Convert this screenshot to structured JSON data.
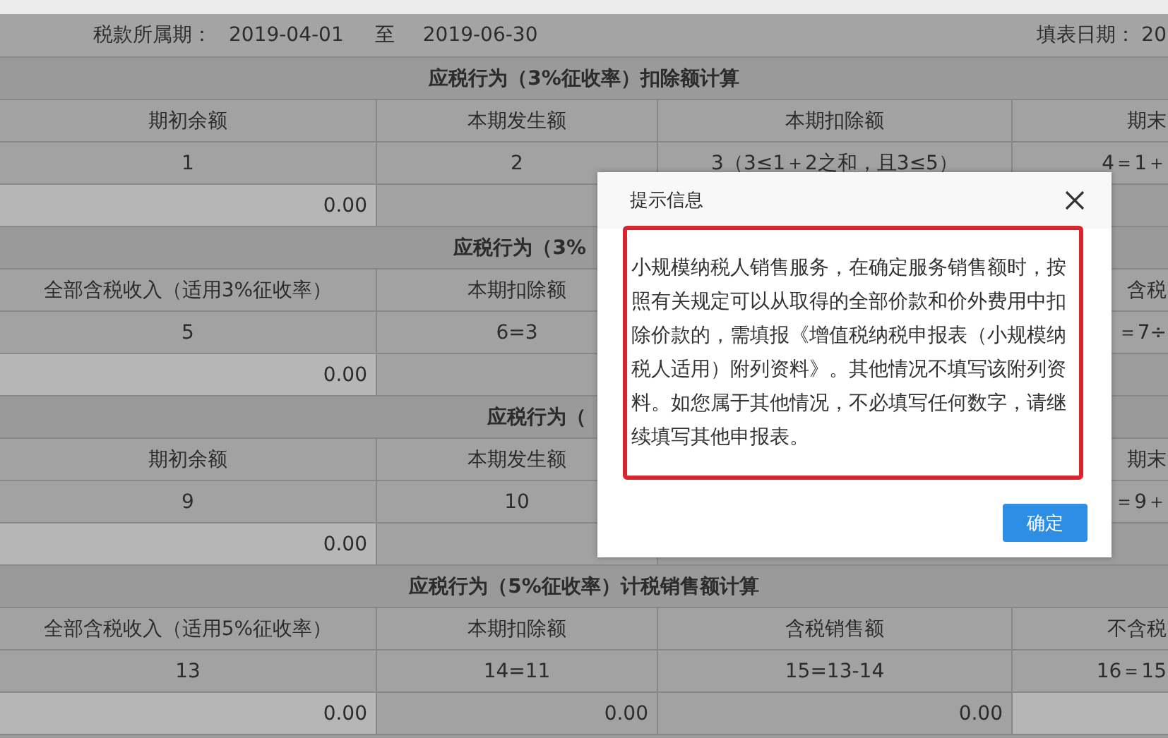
{
  "header": {
    "period_label": "税款所属期：",
    "start_date": "2019-04-01",
    "to_label": "至",
    "end_date": "2019-06-30",
    "fill_date_label": "填表日期：",
    "fill_date": "20"
  },
  "sections": [
    {
      "title": "应税行为（3%征收率）扣除额计算",
      "kind": "full",
      "headers": [
        "期初余额",
        "本期发生额",
        "本期扣除额",
        "期末"
      ],
      "numbers": [
        "1",
        "2",
        "3（3≤1＋2之和，且3≤5）",
        "4＝1＋"
      ],
      "values": [
        {
          "text": "0.00",
          "editable": true
        },
        {
          "editable": false
        }
      ]
    },
    {
      "title": "应税行为（3%",
      "kind": "covered",
      "headers": [
        "全部含税收入（适用3%征收率）",
        "本期扣除额",
        "含税"
      ],
      "numbers": [
        "5",
        "6=3",
        "＝7÷"
      ],
      "values": [
        {
          "text": "0.00",
          "editable": true
        },
        {
          "editable": false
        }
      ]
    },
    {
      "title": "应税行为（",
      "kind": "covered",
      "headers": [
        "期初余额",
        "本期发生额",
        "期末"
      ],
      "numbers": [
        "9",
        "10",
        "＝9＋"
      ],
      "values": [
        {
          "text": "0.00",
          "editable": true
        },
        {
          "editable": false
        }
      ]
    },
    {
      "title": "应税行为（5%征收率）计税销售额计算",
      "kind": "full",
      "headers": [
        "全部含税收入（适用5%征收率）",
        "本期扣除额",
        "含税销售额",
        "不含税"
      ],
      "numbers": [
        "13",
        "14=11",
        "15=13-14",
        "16＝15"
      ],
      "values": [
        {
          "text": "0.00",
          "editable": true
        },
        {
          "text": "0.00",
          "editable": false
        },
        {
          "text": "0.00",
          "editable": false
        },
        {
          "editable": true
        }
      ]
    }
  ],
  "dialog": {
    "title": "提示信息",
    "message": "小规模纳税人销售服务，在确定服务销售额时，按照有关规定可以从取得的全部价款和价外费用中扣除价款的，需填报《增值税纳税申报表（小规模纳税人适用）附列资料》。其他情况不填写该附列资料。如您属于其他情况，不必填写任何数字，请继续填写其他申报表。",
    "button": "确定"
  }
}
